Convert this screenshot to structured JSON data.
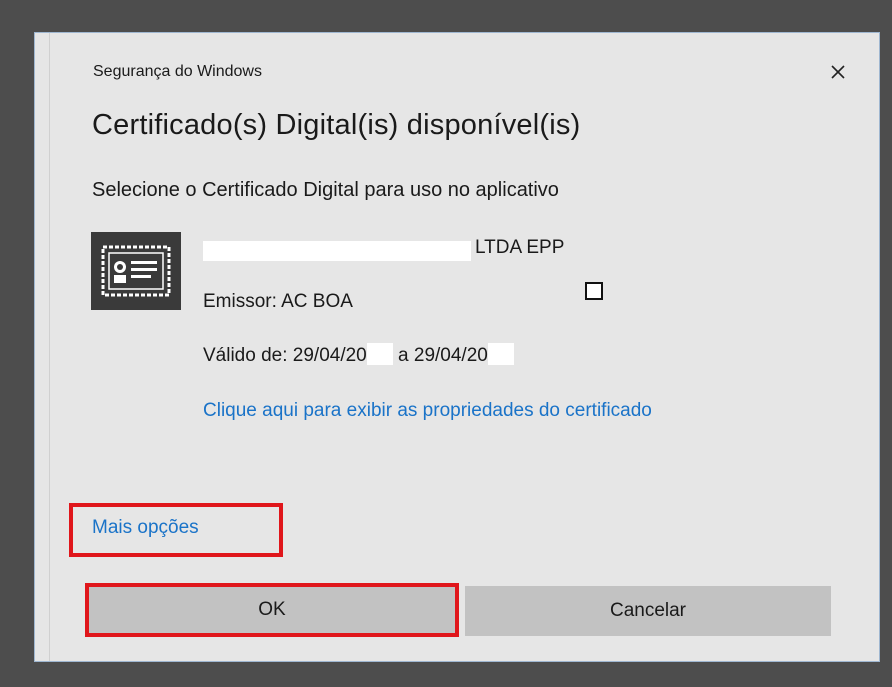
{
  "dialog": {
    "caption": "Segurança do Windows",
    "title": "Certificado(s) Digital(is) disponível(is)",
    "subtitle": "Selecione o Certificado Digital para uso no aplicativo"
  },
  "certificate": {
    "icon": "certificate-icon",
    "name_visible": "LTDA EPP",
    "issuer": "Emissor: AC BOA",
    "validity_prefix": "Válido de: 29/04/20",
    "validity_middle": " a 29/04/20",
    "properties_link": "Clique aqui para exibir as propriedades do certificado"
  },
  "more_options": "Mais opções",
  "buttons": {
    "ok": "OK",
    "cancel": "Cancelar"
  },
  "colors": {
    "link": "#1a73c8",
    "highlight": "#e0161b",
    "button": "#c2c2c2",
    "dialog_bg": "#e6e6e6"
  }
}
